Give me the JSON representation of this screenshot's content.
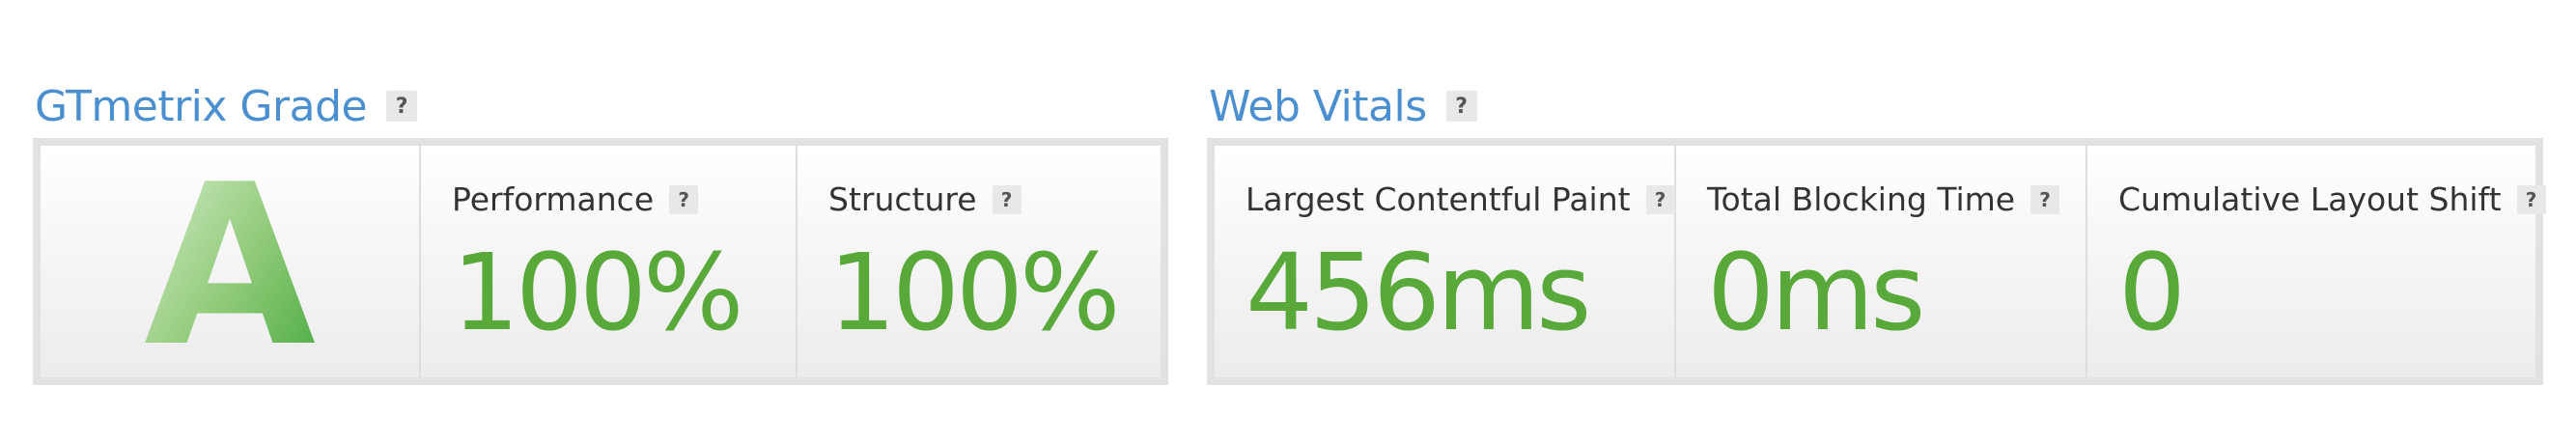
{
  "grade_panel": {
    "title": "GTmetrix Grade",
    "help": "?",
    "grade": "A",
    "metrics": [
      {
        "label": "Performance",
        "value": "100%",
        "help": "?"
      },
      {
        "label": "Structure",
        "value": "100%",
        "help": "?"
      }
    ]
  },
  "vitals_panel": {
    "title": "Web Vitals",
    "help": "?",
    "metrics": [
      {
        "label": "Largest Contentful Paint",
        "value": "456ms",
        "help": "?"
      },
      {
        "label": "Total Blocking Time",
        "value": "0ms",
        "help": "?"
      },
      {
        "label": "Cumulative Layout Shift",
        "value": "0",
        "help": "?"
      }
    ]
  },
  "colors": {
    "title_blue": "#4a8fd0",
    "value_green": "#58a83a",
    "grade_green_light": "#cde6c2",
    "grade_green_dark": "#4caf50",
    "border_gray": "#e2e2e2"
  }
}
